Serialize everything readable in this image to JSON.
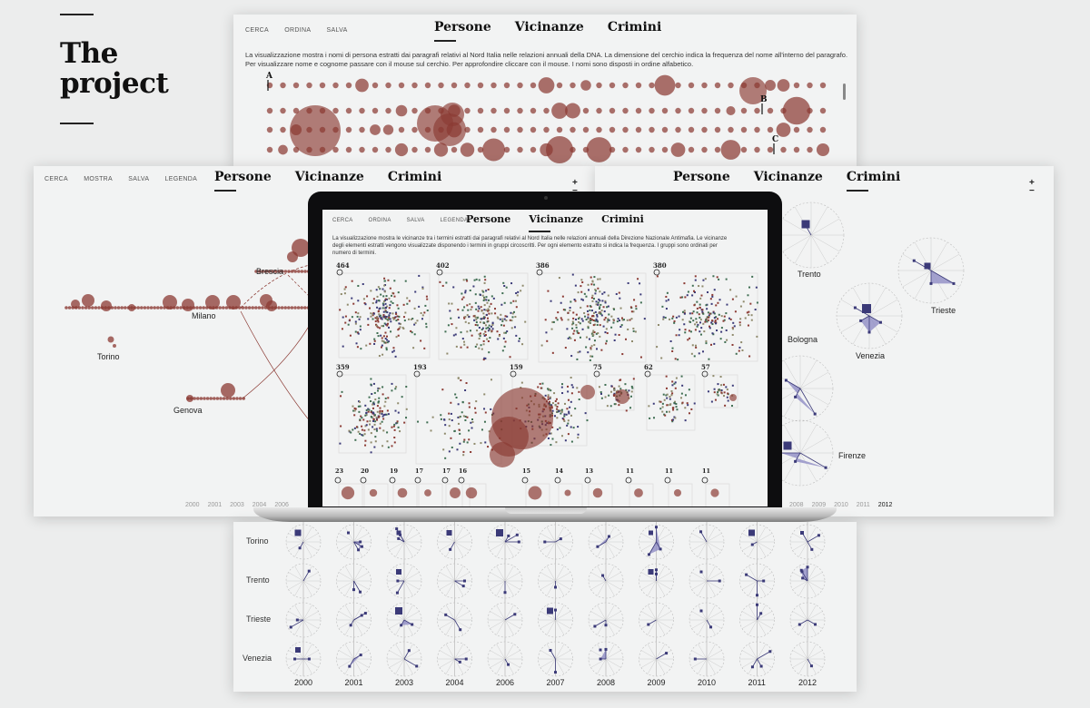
{
  "project": {
    "title_line1": "The",
    "title_line2": "project"
  },
  "panel_top": {
    "menu": [
      "CERCA",
      "ORDINA",
      "SALVA"
    ],
    "tabs": [
      {
        "label": "Persone",
        "active": true
      },
      {
        "label": "Vicinanze",
        "active": false
      },
      {
        "label": "Crimini",
        "active": false
      }
    ],
    "description": "La visualizzazione mostra i nomi di persona estratti dai paragrafi relativi al Nord Italia nelle relazioni annuali della DNA. La dimensione del cerchio indica la frequenza del nome all'interno del paragrafo. Per visualizzare nome e cognome passare con il mouse sul cerchio. Per approfondire cliccare con il mouse. I nomi sono disposti in ordine alfabetico.",
    "letters": [
      "A",
      "B",
      "C"
    ]
  },
  "panel_left": {
    "menu": [
      "CERCA",
      "MOSTRA",
      "SALVA",
      "LEGENDA"
    ],
    "tabs": [
      {
        "label": "Persone",
        "active": true
      },
      {
        "label": "Vicinanze",
        "active": false
      },
      {
        "label": "Crimini",
        "active": false
      }
    ],
    "cities": [
      "Brescia",
      "Milano",
      "Torino",
      "Genova"
    ],
    "years": [
      "2000",
      "2001",
      "2003",
      "2004",
      "2006"
    ],
    "zoom_in": "+",
    "zoom_out": "−"
  },
  "panel_right": {
    "tabs": [
      {
        "label": "Persone",
        "active": false
      },
      {
        "label": "Vicinanze",
        "active": false
      },
      {
        "label": "Crimini",
        "active": true
      }
    ],
    "cities": [
      "Trento",
      "Trieste",
      "Venezia",
      "Bologna",
      "Firenze"
    ],
    "years": [
      "2008",
      "2009",
      "2010",
      "2011",
      "2012"
    ],
    "current_year": "2012",
    "zoom_in": "+",
    "zoom_out": "−"
  },
  "laptop_screen": {
    "menu": [
      "CERCA",
      "ORDINA",
      "SALVA",
      "LEGENDA"
    ],
    "tabs": [
      {
        "label": "Persone",
        "active": false
      },
      {
        "label": "Vicinanze",
        "active": true
      },
      {
        "label": "Crimini",
        "active": false
      }
    ],
    "description": "La visualizzazione mostra le vicinanze tra i termini estratti dai paragrafi relativi al Nord Italia nelle relazioni annuali della Direzione Nazionale Antimafia. Le vicinanze degli elementi estratti vengono visualizzate disponendo i termini in gruppi circoscritti. Per ogni elemento estratto si indica la frequenza. I gruppi sono ordinati per numero di termini.",
    "group_counts_row1": [
      "464",
      "402",
      "386",
      "380"
    ],
    "group_counts_row2": [
      "359",
      "193",
      "159",
      "75",
      "62",
      "57"
    ],
    "group_counts_row3": [
      "23",
      "20",
      "19",
      "17",
      "17",
      "16",
      "15",
      "14",
      "13",
      "11",
      "11",
      "11"
    ]
  },
  "panel_bottom": {
    "rows": [
      "Torino",
      "Trento",
      "Trieste",
      "Venezia"
    ],
    "years": [
      "2000",
      "2001",
      "2003",
      "2004",
      "2006",
      "2007",
      "2008",
      "2009",
      "2010",
      "2011",
      "2012"
    ]
  },
  "colors": {
    "bubble": "#8b3a33",
    "radar": "#3b3a78",
    "radar_fill": "#8f8cc4",
    "green": "#3f6e52",
    "tan": "#8f8a6c"
  }
}
